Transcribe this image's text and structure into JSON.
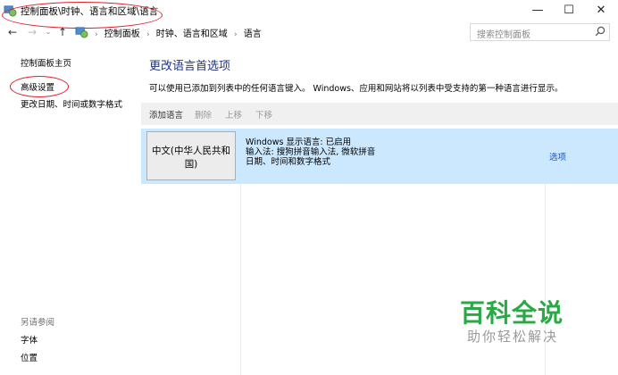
{
  "window": {
    "title": "控制面板\\时钟、语言和区域\\语言",
    "minimize": "—",
    "maximize": "☐",
    "close": "✕"
  },
  "addressbar": {
    "back": "←",
    "forward": "→",
    "recent": "⌄",
    "up": "↑",
    "crumbs": [
      "控制面板",
      "时钟、语言和区域",
      "语言"
    ],
    "separator": "›",
    "dropdown": "⌄",
    "refresh": "↻"
  },
  "search": {
    "placeholder": "搜索控制面板"
  },
  "sidebar": {
    "home": "控制面板主页",
    "advanced": "高级设置",
    "datetime": "更改日期、时间或数字格式",
    "see_also": "另请参阅",
    "font": "字体",
    "location": "位置"
  },
  "main": {
    "title": "更改语言首选项",
    "description": "可以使用已添加到列表中的任何语言键入。 Windows、应用和网站将以列表中受支持的第一种语言进行显示。",
    "toolbar": {
      "add": "添加语言",
      "remove": "删除",
      "up": "上移",
      "down": "下移"
    },
    "language": {
      "name": "中文(中华人民共和国)",
      "display": "Windows 显示语言: 已启用",
      "input": "输入法: 搜狗拼音输入法, 微软拼音",
      "format": "日期、时间和数字格式",
      "options": "选项"
    }
  },
  "watermark": {
    "title": "百科全说",
    "subtitle": "助你轻松解决"
  },
  "colors": {
    "link": "#1e3287",
    "selected_row": "#cce8ff",
    "annotation": "#e0202a",
    "watermark": "#2aa845"
  }
}
